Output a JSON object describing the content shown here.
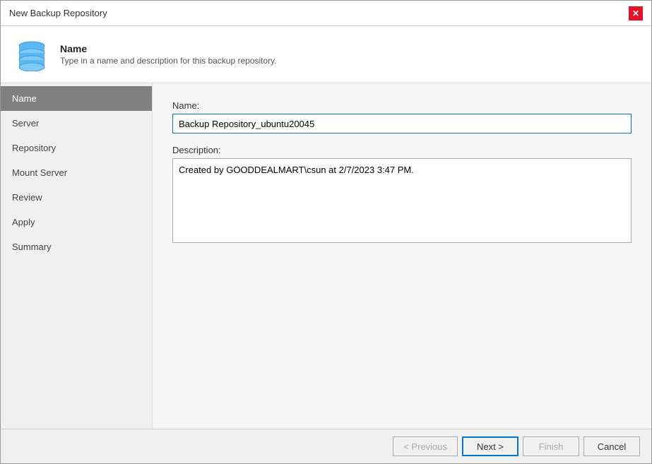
{
  "dialog": {
    "title": "New Backup Repository",
    "close_label": "✕"
  },
  "header": {
    "title": "Name",
    "description": "Type in a name and description for this backup repository.",
    "icon": "database-icon"
  },
  "sidebar": {
    "items": [
      {
        "label": "Name",
        "active": true
      },
      {
        "label": "Server",
        "active": false
      },
      {
        "label": "Repository",
        "active": false
      },
      {
        "label": "Mount Server",
        "active": false
      },
      {
        "label": "Review",
        "active": false
      },
      {
        "label": "Apply",
        "active": false
      },
      {
        "label": "Summary",
        "active": false
      }
    ]
  },
  "form": {
    "name_label": "Name:",
    "name_value": "Backup Repository_ubuntu20045",
    "description_label": "Description:",
    "description_value": "Created by GOODDEALMART\\csun at 2/7/2023 3:47 PM."
  },
  "footer": {
    "previous_label": "< Previous",
    "next_label": "Next >",
    "finish_label": "Finish",
    "cancel_label": "Cancel"
  }
}
